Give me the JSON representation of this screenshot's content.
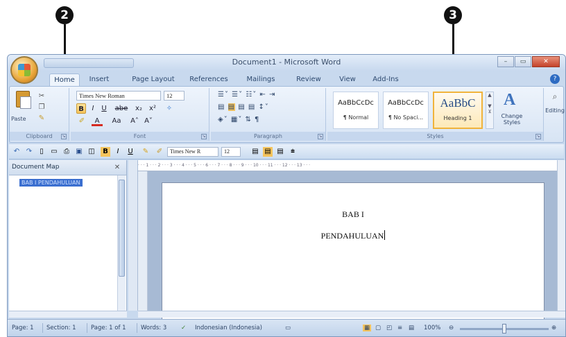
{
  "callouts": {
    "left": "2",
    "right": "3"
  },
  "window": {
    "title": "Document1 - Microsoft Word",
    "controls": {
      "minimize": "–",
      "maximize": "▭",
      "close": "✕"
    },
    "help": "?"
  },
  "tabs": [
    "Home",
    "Insert",
    "Page Layout",
    "References",
    "Mailings",
    "Review",
    "View",
    "Add-Ins"
  ],
  "ribbon": {
    "clipboard": {
      "paste": "Paste",
      "label": "Clipboard"
    },
    "font": {
      "name": "Times New Roman",
      "size": "12",
      "row1": [
        "B",
        "I",
        "U",
        "abe",
        "x₂",
        "x²"
      ],
      "row2": [
        "A",
        "Aa",
        "A˄",
        "A˅"
      ],
      "label": "Font"
    },
    "paragraph": {
      "label": "Paragraph"
    },
    "styles": {
      "tiles": [
        {
          "sample": "AaBbCcDc",
          "name": "¶ Normal"
        },
        {
          "sample": "AaBbCcDc",
          "name": "¶ No Spaci..."
        },
        {
          "sample": "AaBbC",
          "name": "Heading 1"
        }
      ],
      "change_styles": "Change Styles",
      "label": "Styles"
    },
    "editing": {
      "label": "Editing"
    }
  },
  "quick_toolbar": {
    "font": "Times New R",
    "size": "12"
  },
  "document_map": {
    "title": "Document Map",
    "item": "BAB I PENDAHULUAN"
  },
  "document": {
    "line1": "BAB I",
    "line2": "PENDAHULUAN"
  },
  "ruler_text": "· · · 1 · · · 2 · · · 3 · · · 4 · · · 5 · · · 6 · · · 7 · · · 8 · · · 9 · · · 10 · · · 11 · · · 12 · · · 13 · · ·",
  "status": {
    "page": "Page: 1",
    "section": "Section: 1",
    "page_of": "Page: 1 of 1",
    "words": "Words: 3",
    "language": "Indonesian (Indonesia)",
    "zoom": "100%"
  }
}
